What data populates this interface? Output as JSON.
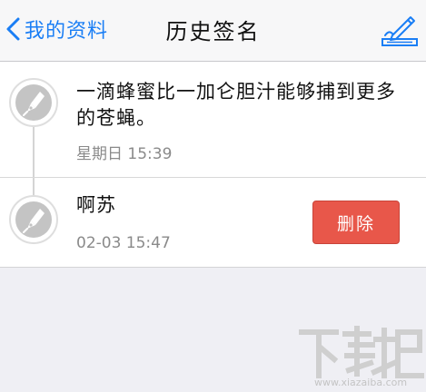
{
  "nav": {
    "back_label": "我的资料",
    "title": "历史签名"
  },
  "signatures": [
    {
      "text": "一滴蜂蜜比一加仑胆汁能够捕到更多的苍蝇。",
      "time": "星期日 15:39"
    },
    {
      "text": "啊苏",
      "time": "02-03 15:47",
      "delete_label": "删除"
    }
  ],
  "watermark": {
    "logo": "下载吧",
    "domain": "www.xiazaiba.com"
  },
  "colors": {
    "accent": "#1a7ef5",
    "delete": "#e8574a",
    "background": "#efeff4"
  },
  "icons": {
    "back": "chevron-left-icon",
    "edit": "edit-signature-icon",
    "avatar": "pen-nib-icon"
  }
}
